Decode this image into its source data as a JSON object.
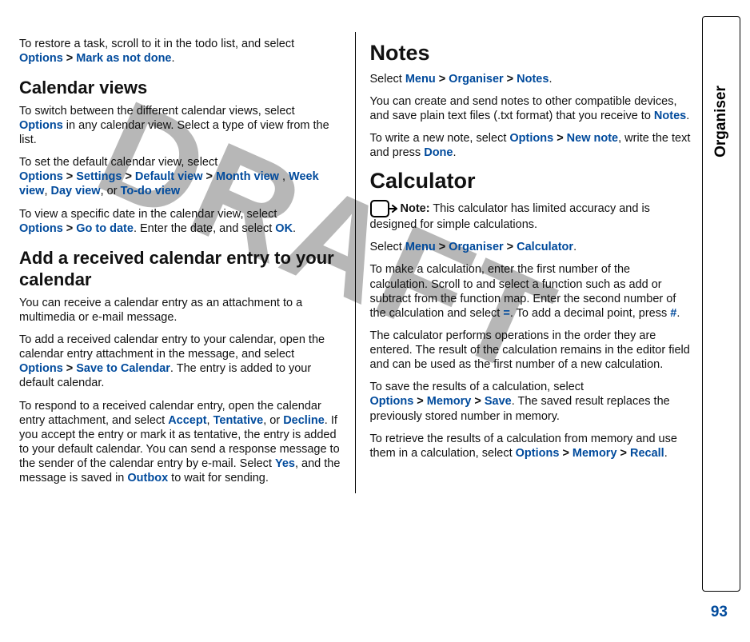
{
  "watermark": "DRAFT",
  "sideTab": {
    "label": "Organiser"
  },
  "pageNumber": "93",
  "left": {
    "restore": {
      "pre": "To restore a task, scroll to it in the todo list, and select ",
      "options": "Options",
      "markNotDone": "Mark as not done",
      "end": "."
    },
    "calendarViews": {
      "heading": "Calendar views",
      "p1_pre": "To switch between the different calendar views, select ",
      "p1_options": "Options",
      "p1_post": " in any calendar view. Select a type of view from the list.",
      "p2_pre": "To set the default calendar view, select ",
      "p2_options": "Options",
      "p2_settings": "Settings",
      "p2_default": "Default view",
      "p2_month": "Month view",
      "p2_sep": " , ",
      "p2_week": "Week view",
      "p2_comma": ", ",
      "p2_day": "Day view",
      "p2_or": ", or ",
      "p2_todo": "To-do view",
      "p3_pre": "To view a specific date in the calendar view, select ",
      "p3_options": "Options",
      "p3_goto": "Go to date",
      "p3_mid": ". Enter the date, and select ",
      "p3_ok": "OK",
      "p3_end": "."
    },
    "addEntry": {
      "heading": "Add a received calendar entry to your calendar",
      "p1": "You can receive a calendar entry as an attachment to a multimedia or e-mail message.",
      "p2_pre": "To add a received calendar entry to your calendar, open the calendar entry attachment in the message, and select ",
      "p2_options": "Options",
      "p2_save": "Save to Calendar",
      "p2_post": ". The entry is added to your default calendar.",
      "p3_pre": "To respond to a received calendar entry, open the calendar entry attachment, and select ",
      "p3_accept": "Accept",
      "p3_c1": ", ",
      "p3_tentative": "Tentative",
      "p3_c2": ", or ",
      "p3_decline": "Decline",
      "p3_mid": ". If you accept the entry or mark it as tentative, the entry is added to your default calendar. You can send a response message to the sender of the calendar entry by e-mail. Select ",
      "p3_yes": "Yes",
      "p3_mid2": ", and the message is saved in ",
      "p3_outbox": "Outbox",
      "p3_end": " to wait for sending."
    }
  },
  "right": {
    "notes": {
      "heading": "Notes",
      "p1_pre": "Select ",
      "p1_menu": "Menu",
      "p1_org": "Organiser",
      "p1_notes": "Notes",
      "p1_end": ".",
      "p2_pre": "You can create and send notes to other compatible devices, and save plain text files (.txt format) that you receive to ",
      "p2_notes": "Notes",
      "p2_end": ".",
      "p3_pre": "To write a new note, select ",
      "p3_options": "Options",
      "p3_newnote": "New note",
      "p3_mid": ", write the text and press ",
      "p3_done": "Done",
      "p3_end": "."
    },
    "calc": {
      "heading": "Calculator",
      "note_label": "Note:",
      "note_text": "  This calculator has limited accuracy and is designed for simple calculations.",
      "p1_pre": "Select ",
      "p1_menu": "Menu",
      "p1_org": "Organiser",
      "p1_calc": "Calculator",
      "p1_end": ".",
      "p2_pre": "To make a calculation, enter the first number of the calculation. Scroll to and select a function such as add or subtract from the function map. Enter the second number of the calculation and select ",
      "p2_eq": "=",
      "p2_mid": ". To add a decimal point, press ",
      "p2_hash": "#",
      "p2_end": ".",
      "p3": "The calculator performs operations in the order they are entered. The result of the calculation remains in the editor field and can be used as the first number of a new calculation.",
      "p4_pre": "To save the results of a calculation, select ",
      "p4_options": "Options",
      "p4_memory": "Memory",
      "p4_save": "Save",
      "p4_post": ". The saved result replaces the previously stored number in memory.",
      "p5_pre": "To retrieve the results of a calculation from memory and use them in a calculation, select ",
      "p5_options": "Options",
      "p5_memory": "Memory",
      "p5_recall": "Recall",
      "p5_end": "."
    }
  }
}
